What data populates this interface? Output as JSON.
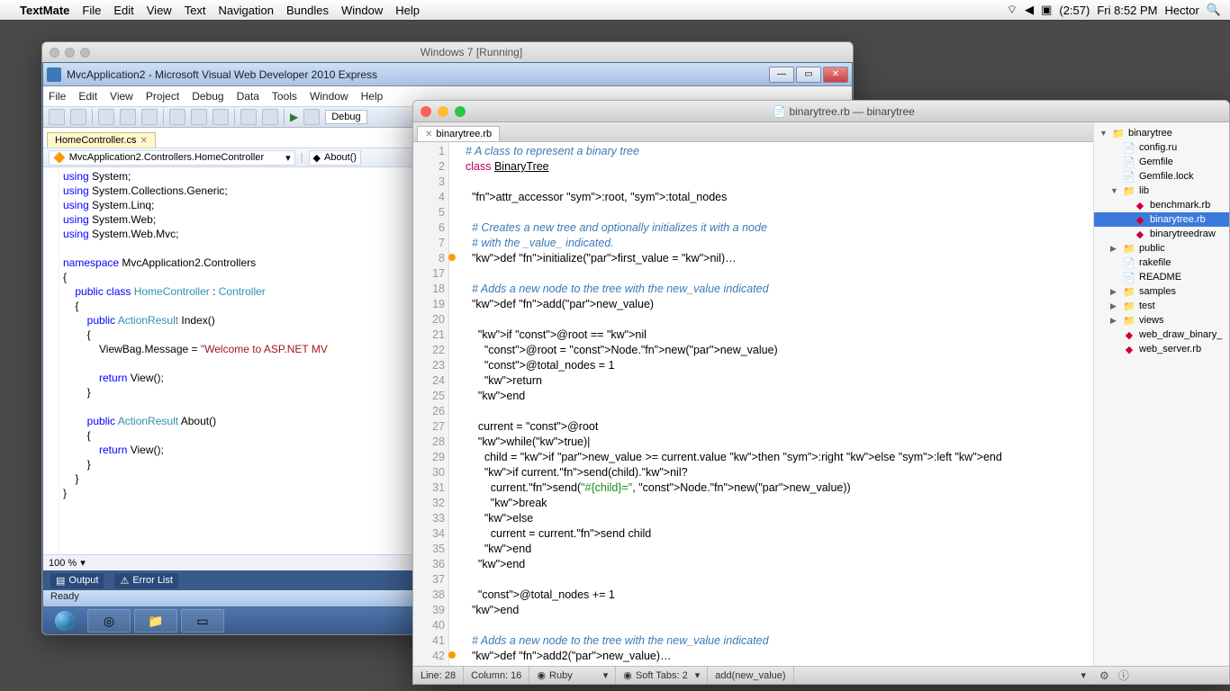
{
  "menubar": {
    "app": "TextMate",
    "items": [
      "File",
      "Edit",
      "View",
      "Text",
      "Navigation",
      "Bundles",
      "Window",
      "Help"
    ],
    "battery": "(2:57)",
    "clock": "Fri 8:52 PM",
    "user": "Hector"
  },
  "vm": {
    "title": "Windows 7 [Running]"
  },
  "vs": {
    "title": "MvcApplication2 - Microsoft Visual Web Developer 2010 Express",
    "menu": [
      "File",
      "Edit",
      "View",
      "Project",
      "Debug",
      "Data",
      "Tools",
      "Window",
      "Help"
    ],
    "config": "Debug",
    "tab": "HomeController.cs",
    "nav_left": "MvcApplication2.Controllers.HomeController",
    "nav_right": "About()",
    "zoom": "100 %",
    "panels": {
      "output": "Output",
      "errors": "Error List"
    },
    "status": "Ready",
    "code": {
      "usings": [
        "System",
        "System.Collections.Generic",
        "System.Linq",
        "System.Web",
        "System.Web.Mvc"
      ],
      "ns": "MvcApplication2.Controllers",
      "class": "HomeController",
      "base": "Controller",
      "m1": "Index",
      "m1_body1": "ViewBag.Message = ",
      "m1_str": "\"Welcome to ASP.NET MV",
      "m2": "About",
      "ret": "return",
      "view": "View"
    }
  },
  "tm": {
    "title": "binarytree.rb — binarytree",
    "tab": "binarytree.rb",
    "status": {
      "line": "Line: 28",
      "col": "Column: 16",
      "lang": "Ruby",
      "tabs": "Soft Tabs:   2",
      "sym": "add(new_value)"
    },
    "lines": [
      {
        "n": 1,
        "t": "cm",
        "s": "# A class to represent a binary tree"
      },
      {
        "n": 2,
        "t": "",
        "s": "class BinaryTree"
      },
      {
        "n": 3,
        "t": "",
        "s": ""
      },
      {
        "n": 4,
        "t": "",
        "s": "  attr_accessor :root, :total_nodes"
      },
      {
        "n": 5,
        "t": "",
        "s": ""
      },
      {
        "n": 6,
        "t": "cm",
        "s": "  # Creates a new tree and optionally initializes it with a node"
      },
      {
        "n": 7,
        "t": "cm",
        "s": "  # with the _value_ indicated."
      },
      {
        "n": 8,
        "t": "",
        "s": "  def initialize(first_value = nil)…",
        "mark": true
      },
      {
        "n": 17,
        "t": "",
        "s": ""
      },
      {
        "n": 18,
        "t": "cm",
        "s": "  # Adds a new node to the tree with the new_value indicated"
      },
      {
        "n": 19,
        "t": "",
        "s": "  def add(new_value)"
      },
      {
        "n": 20,
        "t": "",
        "s": ""
      },
      {
        "n": 21,
        "t": "",
        "s": "    if @root == nil"
      },
      {
        "n": 22,
        "t": "",
        "s": "      @root = Node.new(new_value)"
      },
      {
        "n": 23,
        "t": "",
        "s": "      @total_nodes = 1"
      },
      {
        "n": 24,
        "t": "",
        "s": "      return"
      },
      {
        "n": 25,
        "t": "",
        "s": "    end"
      },
      {
        "n": 26,
        "t": "",
        "s": ""
      },
      {
        "n": 27,
        "t": "",
        "s": "    current = @root"
      },
      {
        "n": 28,
        "t": "",
        "s": "    while(true)|"
      },
      {
        "n": 29,
        "t": "",
        "s": "      child = if new_value >= current.value then :right else :left end"
      },
      {
        "n": 30,
        "t": "",
        "s": "      if current.send(child).nil?"
      },
      {
        "n": 31,
        "t": "",
        "s": "        current.send(\"#{child}=\", Node.new(new_value))"
      },
      {
        "n": 32,
        "t": "",
        "s": "        break"
      },
      {
        "n": 33,
        "t": "",
        "s": "      else"
      },
      {
        "n": 34,
        "t": "",
        "s": "        current = current.send child"
      },
      {
        "n": 35,
        "t": "",
        "s": "      end"
      },
      {
        "n": 36,
        "t": "",
        "s": "    end"
      },
      {
        "n": 37,
        "t": "",
        "s": ""
      },
      {
        "n": 38,
        "t": "",
        "s": "    @total_nodes += 1"
      },
      {
        "n": 39,
        "t": "",
        "s": "  end"
      },
      {
        "n": 40,
        "t": "",
        "s": ""
      },
      {
        "n": 41,
        "t": "cm",
        "s": "  # Adds a new node to the tree with the new_value indicated"
      },
      {
        "n": 42,
        "t": "",
        "s": "  def add2(new_value)…",
        "mark": true
      }
    ]
  },
  "drawer": {
    "root": "binarytree",
    "items": [
      {
        "l": "config.ru",
        "k": "file",
        "d": 1
      },
      {
        "l": "Gemfile",
        "k": "file",
        "d": 1
      },
      {
        "l": "Gemfile.lock",
        "k": "file",
        "d": 1
      },
      {
        "l": "lib",
        "k": "folder",
        "d": 1,
        "open": true
      },
      {
        "l": "benchmark.rb",
        "k": "rb",
        "d": 2
      },
      {
        "l": "binarytree.rb",
        "k": "rb",
        "d": 2,
        "sel": true
      },
      {
        "l": "binarytreedraw",
        "k": "rb",
        "d": 2
      },
      {
        "l": "public",
        "k": "folder",
        "d": 1
      },
      {
        "l": "rakefile",
        "k": "file",
        "d": 1
      },
      {
        "l": "README",
        "k": "file",
        "d": 1
      },
      {
        "l": "samples",
        "k": "folder",
        "d": 1
      },
      {
        "l": "test",
        "k": "folder",
        "d": 1
      },
      {
        "l": "views",
        "k": "folder",
        "d": 1
      },
      {
        "l": "web_draw_binary_",
        "k": "rb",
        "d": 1
      },
      {
        "l": "web_server.rb",
        "k": "rb",
        "d": 1
      }
    ]
  }
}
